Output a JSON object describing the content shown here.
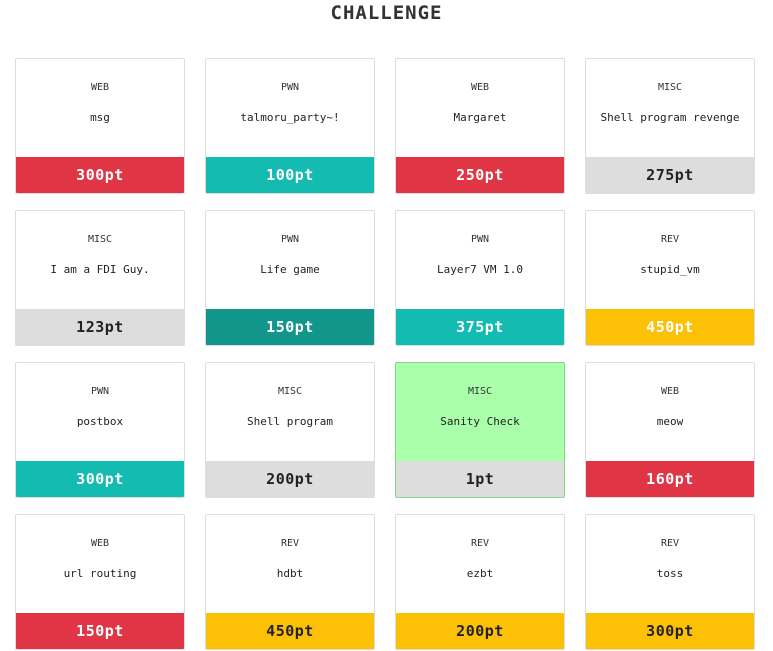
{
  "page": {
    "title": "CHALLENGE"
  },
  "colors": {
    "WEB": "#df3545",
    "PWN": "#14bbb0",
    "PWN_alt": "#12968c",
    "REV": "#fcc107",
    "MISC": "#dddddd",
    "solved_card": "#aaffaa"
  },
  "challenges": [
    {
      "category": "WEB",
      "name": "msg",
      "points": "300pt",
      "bar_color": "#df3545",
      "dark_text": false,
      "solved": false
    },
    {
      "category": "PWN",
      "name": "talmoru_party~!",
      "points": "100pt",
      "bar_color": "#14bbb0",
      "dark_text": false,
      "solved": false
    },
    {
      "category": "WEB",
      "name": "Margaret",
      "points": "250pt",
      "bar_color": "#df3545",
      "dark_text": false,
      "solved": false
    },
    {
      "category": "MISC",
      "name": "Shell program revenge",
      "points": "275pt",
      "bar_color": "#dddddd",
      "dark_text": true,
      "solved": false
    },
    {
      "category": "MISC",
      "name": "I am a FDI Guy.",
      "points": "123pt",
      "bar_color": "#dddddd",
      "dark_text": true,
      "solved": false
    },
    {
      "category": "PWN",
      "name": "Life game",
      "points": "150pt",
      "bar_color": "#12968c",
      "dark_text": false,
      "solved": false
    },
    {
      "category": "PWN",
      "name": "Layer7 VM 1.0",
      "points": "375pt",
      "bar_color": "#14bbb0",
      "dark_text": false,
      "solved": false
    },
    {
      "category": "REV",
      "name": "stupid_vm",
      "points": "450pt",
      "bar_color": "#fcc107",
      "dark_text": false,
      "solved": false
    },
    {
      "category": "PWN",
      "name": "postbox",
      "points": "300pt",
      "bar_color": "#14bbb0",
      "dark_text": false,
      "solved": false
    },
    {
      "category": "MISC",
      "name": "Shell program",
      "points": "200pt",
      "bar_color": "#dddddd",
      "dark_text": true,
      "solved": false
    },
    {
      "category": "MISC",
      "name": "Sanity Check",
      "points": "1pt",
      "bar_color": "#dddddd",
      "dark_text": true,
      "solved": true
    },
    {
      "category": "WEB",
      "name": "meow",
      "points": "160pt",
      "bar_color": "#df3545",
      "dark_text": false,
      "solved": false
    },
    {
      "category": "WEB",
      "name": "url routing",
      "points": "150pt",
      "bar_color": "#df3545",
      "dark_text": false,
      "solved": false
    },
    {
      "category": "REV",
      "name": "hdbt",
      "points": "450pt",
      "bar_color": "#fcc107",
      "dark_text": true,
      "solved": false
    },
    {
      "category": "REV",
      "name": "ezbt",
      "points": "200pt",
      "bar_color": "#fcc107",
      "dark_text": true,
      "solved": false
    },
    {
      "category": "REV",
      "name": "toss",
      "points": "300pt",
      "bar_color": "#fcc107",
      "dark_text": true,
      "solved": false
    }
  ]
}
